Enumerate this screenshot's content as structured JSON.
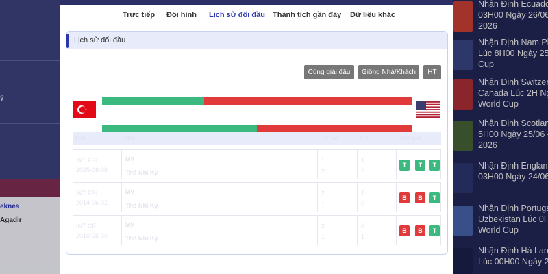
{
  "background_left": {
    "text_1": "ỷ",
    "link_text": "eknes",
    "team_text": "Agadir"
  },
  "sidebar_news": [
    {
      "text": "Nhận Định Ecuado",
      "line2": "03H00 Ngày 26/06",
      "line3": "2026"
    },
    {
      "text": "Nhận Định Nam Ph",
      "line2": "Lúc 8H00 Ngày 25/",
      "line3": "Cup"
    },
    {
      "text": "Nhận Định Switzer",
      "line2": "Canada Lúc 2H Ngà",
      "line3": "World Cup"
    },
    {
      "text": "Nhận Định Scotlan",
      "line2": "5H00 Ngày 25/06 -",
      "line3": "2026"
    },
    {
      "text": "Nhận Định England",
      "line2": "03H00 Ngày 24/06",
      "line3": ""
    },
    {
      "text": "Nhận Định Portuga",
      "line2": "Uzbekistan Lúc 0H",
      "line3": "World Cup"
    },
    {
      "text": "Nhận Định Hà Lan",
      "line2": "Lúc 00H00 Ngày 2",
      "line3": ""
    }
  ],
  "tabs": [
    {
      "label": "Trực tiếp",
      "active": false
    },
    {
      "label": "Đội hình",
      "active": false
    },
    {
      "label": "Lịch sử đối đầu",
      "active": true
    },
    {
      "label": "Thành tích gần đây",
      "active": false
    },
    {
      "label": "Dữ liệu khác",
      "active": false
    }
  ],
  "panel": {
    "title": "Lịch sử đối đầu",
    "buttons": {
      "same_league": "Cùng giải đấu",
      "same_home_away": "Giống Nhà/Khách",
      "ht": "HT"
    }
  },
  "teams": {
    "home_flag": "turkey-flag-icon",
    "away_flag": "usa-flag-icon"
  },
  "stat_bars": [
    {
      "home_share": 0.33
    },
    {
      "home_share": 0.5
    }
  ],
  "table": {
    "headers": [
      "Giải",
      "Đội",
      "Tỉ số",
      "HT",
      "Kết quả"
    ],
    "rows": [
      {
        "league": "INT FRL",
        "date": "2025-06-08",
        "team1": "Mỹ",
        "team2": "Thổ Nhĩ Kỳ",
        "score1": "1",
        "score2": "2",
        "ht1": "1",
        "ht2": "2",
        "results": [
          "T",
          "T",
          "T"
        ]
      },
      {
        "league": "INT FRL",
        "date": "2014-06-02",
        "team1": "Mỹ",
        "team2": "Thổ Nhĩ Kỳ",
        "score1": "2",
        "score2": "1",
        "ht1": "1",
        "ht2": "0",
        "results": [
          "B",
          "B",
          "T"
        ]
      },
      {
        "league": "INT CF",
        "date": "2010-05-30",
        "team1": "Mỹ",
        "team2": "Thổ Nhĩ Kỳ",
        "score1": "2",
        "score2": "1",
        "ht1": "0",
        "ht2": "1",
        "results": [
          "B",
          "B",
          "T"
        ]
      }
    ]
  },
  "colors": {
    "win": "#3cb97e",
    "loss": "#e03a3a",
    "accent": "#2a35b0"
  }
}
